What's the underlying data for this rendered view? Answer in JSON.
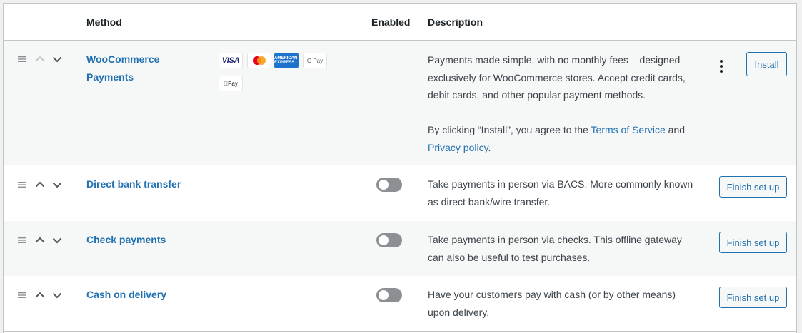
{
  "header": {
    "method": "Method",
    "enabled": "Enabled",
    "description": "Description"
  },
  "rows": [
    {
      "name": "WooCommerce Payments",
      "name_line1": "WooCommerce",
      "name_line2": "Payments",
      "cards": [
        "VISA",
        "mastercard",
        "AMERICAN EXPRESS",
        "G Pay",
        "Apple Pay"
      ],
      "card_text": {
        "visa": "VISA",
        "amex": "AMERICAN EXPRESS",
        "gpay": "G Pay",
        "apay": "Pay"
      },
      "description_p1": "Payments made simple, with no monthly fees – designed exclusively for WooCommerce stores. Accept credit cards, debit cards, and other popular payment methods.",
      "consent_prefix": "By clicking “Install”, you agree to the ",
      "terms_link": "Terms of Service",
      "consent_and": " and",
      "privacy_link": "Privacy policy",
      "consent_suffix": ".",
      "action_label": "Install",
      "enabled": null
    },
    {
      "name": "Direct bank transfer",
      "description": "Take payments in person via BACS. More commonly known as direct bank/wire transfer.",
      "action_label": "Finish set up",
      "enabled": false
    },
    {
      "name": "Check payments",
      "description": "Take payments in person via checks. This offline gateway can also be useful to test purchases.",
      "action_label": "Finish set up",
      "enabled": false
    },
    {
      "name": "Cash on delivery",
      "description": "Have your customers pay with cash (or by other means) upon delivery.",
      "action_label": "Finish set up",
      "enabled": false
    }
  ],
  "colors": {
    "link": "#2271b1",
    "toggle_off": "#8c8f94",
    "row_alt": "#f6f7f7",
    "border": "#c3c4c7"
  },
  "icons": [
    "drag-handle-icon",
    "chevron-up-icon",
    "chevron-down-icon",
    "more-vertical-icon"
  ]
}
